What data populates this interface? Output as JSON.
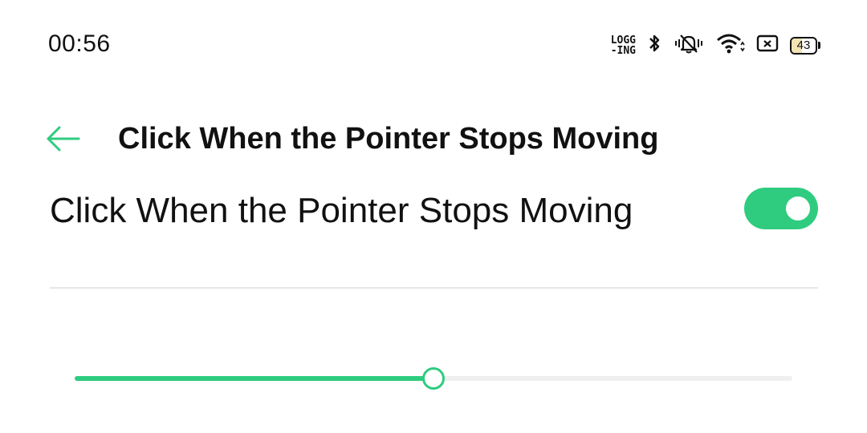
{
  "status_bar": {
    "time": "00:56",
    "logging_line1": "LOGG",
    "logging_line2": "-ING",
    "icons": [
      "bluetooth-icon",
      "vibrate-icon",
      "wifi-icon",
      "screen-record-icon",
      "battery-icon"
    ],
    "battery_level": "43"
  },
  "header": {
    "back_icon": "arrow-left-icon",
    "title": "Click When the Pointer Stops Moving"
  },
  "setting": {
    "label": "Click When the Pointer Stops Moving",
    "toggle_on": true
  },
  "slider": {
    "value_fraction": 0.5
  },
  "colors": {
    "accent": "#2fcc7f",
    "text": "#111111",
    "divider": "#e6e6e6",
    "track": "#efefef"
  }
}
